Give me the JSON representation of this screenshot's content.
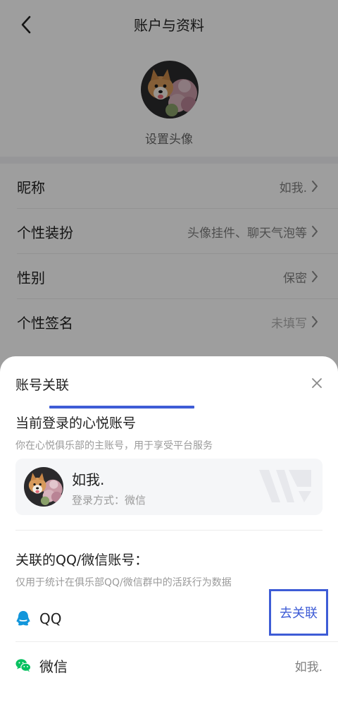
{
  "header": {
    "title": "账户与资料"
  },
  "avatar": {
    "caption": "设置头像"
  },
  "profile_rows": [
    {
      "label": "昵称",
      "value": "如我."
    },
    {
      "label": "个性装扮",
      "value": "头像挂件、聊天气泡等"
    },
    {
      "label": "性别",
      "value": "保密"
    },
    {
      "label": "个性签名",
      "value": "未填写"
    }
  ],
  "sheet": {
    "title": "账号关联",
    "current": {
      "title": "当前登录的心悦账号",
      "subtitle": "你在心悦俱乐部的主账号，用于享受平台服务",
      "name": "如我.",
      "method": "登录方式：微信"
    },
    "linked": {
      "title": "关联的QQ/微信账号：",
      "subtitle": "仅用于统计在俱乐部QQ/微信群中的活跃行为数据",
      "qq": {
        "label": "QQ",
        "action": "去关联"
      },
      "wechat": {
        "label": "微信",
        "value": "如我."
      }
    }
  },
  "colors": {
    "accent": "#3e5cd6",
    "wechat": "#07c160",
    "qq": "#1296db"
  }
}
